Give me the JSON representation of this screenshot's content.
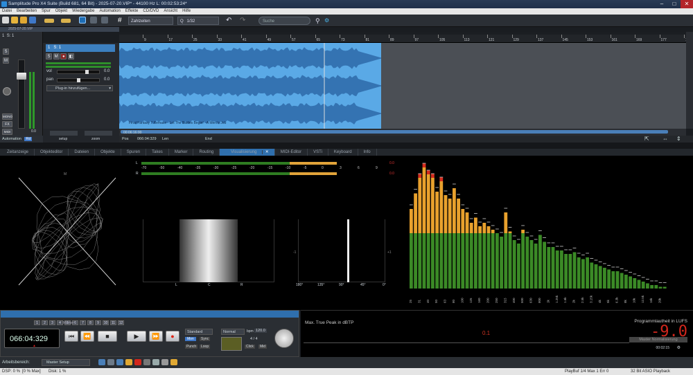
{
  "window": {
    "title": "Samplitude Pro X4 Suite (Build 681, 64 Bit)  -  2025-07-20.VIP*  -  44100 Hz L: 00:02:53:24*"
  },
  "menu": [
    "Datei",
    "Bearbeiten",
    "Spur",
    "Objekt",
    "Wiedergabe",
    "Automation",
    "Effekte",
    "CD/DVD",
    "Ansicht",
    "Hilfe"
  ],
  "toolbar": {
    "zoom_mode": "Zahlzeiten",
    "grid": "1/32",
    "search_placeholder": "Suche"
  },
  "project": {
    "tab": "2025-07-20.VIP",
    "track_num": "1",
    "track_name": "S: 1"
  },
  "ruler": {
    "ticks": [
      "9",
      "17",
      "25",
      "33",
      "41",
      "49",
      "57",
      "65",
      "73",
      "81",
      "89",
      "97",
      "105",
      "113",
      "121",
      "129",
      "137",
      "145",
      "153",
      "161",
      "169",
      "177",
      "185"
    ]
  },
  "track": {
    "vol_label": "vol",
    "vol_value": "0.0",
    "pan_label": "pan",
    "pan_value": "0.0",
    "plugin_label": "Plug-in hinzufügen...",
    "object_name": "Final Fantasy 7 Remake - Let The Battles Begin! - A Merc's Job",
    "meter_value": "0.0",
    "meter_value2": "0.0"
  },
  "mixer": {
    "mono": "MONO",
    "fx": "FX",
    "midi": "MIDI",
    "s": "S",
    "m": "M"
  },
  "setupbar": {
    "setup": "setup",
    "zoom": "zoom"
  },
  "automation": {
    "label": "Automation",
    "rd": "Rd"
  },
  "posbar": {
    "time": "00:06:16:00",
    "pos_label": "Pos",
    "pos_value": "066:04:329",
    "len_label": "Len",
    "end_label": "End"
  },
  "tabs": [
    "Zeitanzeige",
    "Objekteditor",
    "Dateien",
    "Objekte",
    "Spuren",
    "Takes",
    "Marker",
    "Routing",
    "Visualisierung",
    "MIDI-Editor",
    "VSTi",
    "Keyboard",
    "Info"
  ],
  "active_tab": "Visualisierung",
  "correlation": {
    "label": "M"
  },
  "peak_meter": {
    "L": "L",
    "R": "R",
    "scale": [
      "-70",
      "-50",
      "-40",
      "-35",
      "-30",
      "-25",
      "-20",
      "-15",
      "-10",
      "-5",
      "0",
      "3",
      "6",
      "9"
    ],
    "val_L": "0.0",
    "val_R": "0.0"
  },
  "stereo_field": {
    "labels": [
      "L",
      "C",
      "R"
    ]
  },
  "phase_scope": {
    "ticks": [
      "180°",
      "135°",
      "90°",
      "45°",
      "0°"
    ],
    "left": "-1",
    "right": "+1"
  },
  "spectrum": {
    "bands": [
      46,
      55,
      64,
      70,
      66,
      64,
      56,
      62,
      54,
      52,
      58,
      52,
      46,
      44,
      38,
      41,
      36,
      38,
      36,
      34,
      32,
      30,
      44,
      33,
      28,
      26,
      34,
      30,
      28,
      26,
      31,
      27,
      24,
      24,
      22,
      22,
      20,
      20,
      21,
      18,
      17,
      18,
      15,
      14,
      13,
      12,
      11,
      10,
      10,
      9,
      8,
      7,
      6,
      5,
      4,
      3,
      2,
      2,
      1,
      1
    ],
    "labels": [
      "25",
      "31",
      "40",
      "50",
      "63",
      "80",
      "100",
      "125",
      "160",
      "200",
      "250",
      "315",
      "400",
      "500",
      "630",
      "800",
      "1k",
      "1.25k",
      "1.6k",
      "2k",
      "2.5k",
      "3.15k",
      "4k",
      "5k",
      "6.3k",
      "8k",
      "10k",
      "12.5k",
      "16k",
      "20k"
    ]
  },
  "transport": {
    "time": "066:04:329",
    "counter_label": "Marker",
    "numbers": [
      "1",
      "2",
      "3",
      "4",
      "5",
      "6",
      "7",
      "8",
      "9",
      "10",
      "11",
      "12"
    ],
    "sync_mode": "Standard",
    "mon": "Mon",
    "sync": "Sync",
    "punch": "Punch",
    "loop": "Loop",
    "tempo_mode": "Normal",
    "bpm_label": "bpm",
    "bpm": "120.0",
    "sig": "4 / 4",
    "click": "Click",
    "mid": "Mid"
  },
  "loudness": {
    "peak_title": "Max. True Peak in dBTP",
    "peak_value": "0.1",
    "prog_title": "Programmlautheit in LUFS",
    "prog_value": "-9.0",
    "norm_label": "Master Normalisierung",
    "time": "00:02:15"
  },
  "workbar": {
    "label": "Arbeitsbereich:",
    "value": "Master Setup"
  },
  "status": {
    "dsp": "DSP: 0 %",
    "max": "[0 % Max]",
    "disk": "Disk:  1 %",
    "playbuf": "PlayBuf 1/4  Max 1  Err 0",
    "asio": "32 Bit ASIO Playback"
  },
  "colors": {
    "wave_fill": "#5aa9e6",
    "wave_dark": "#2e6aa8",
    "spectrum_green": "#3b8a26",
    "spectrum_orange": "#e8a12d",
    "spectrum_red": "#d42b1d",
    "loudness_red": "#d2261c",
    "active_tab": "#2f6fad"
  }
}
